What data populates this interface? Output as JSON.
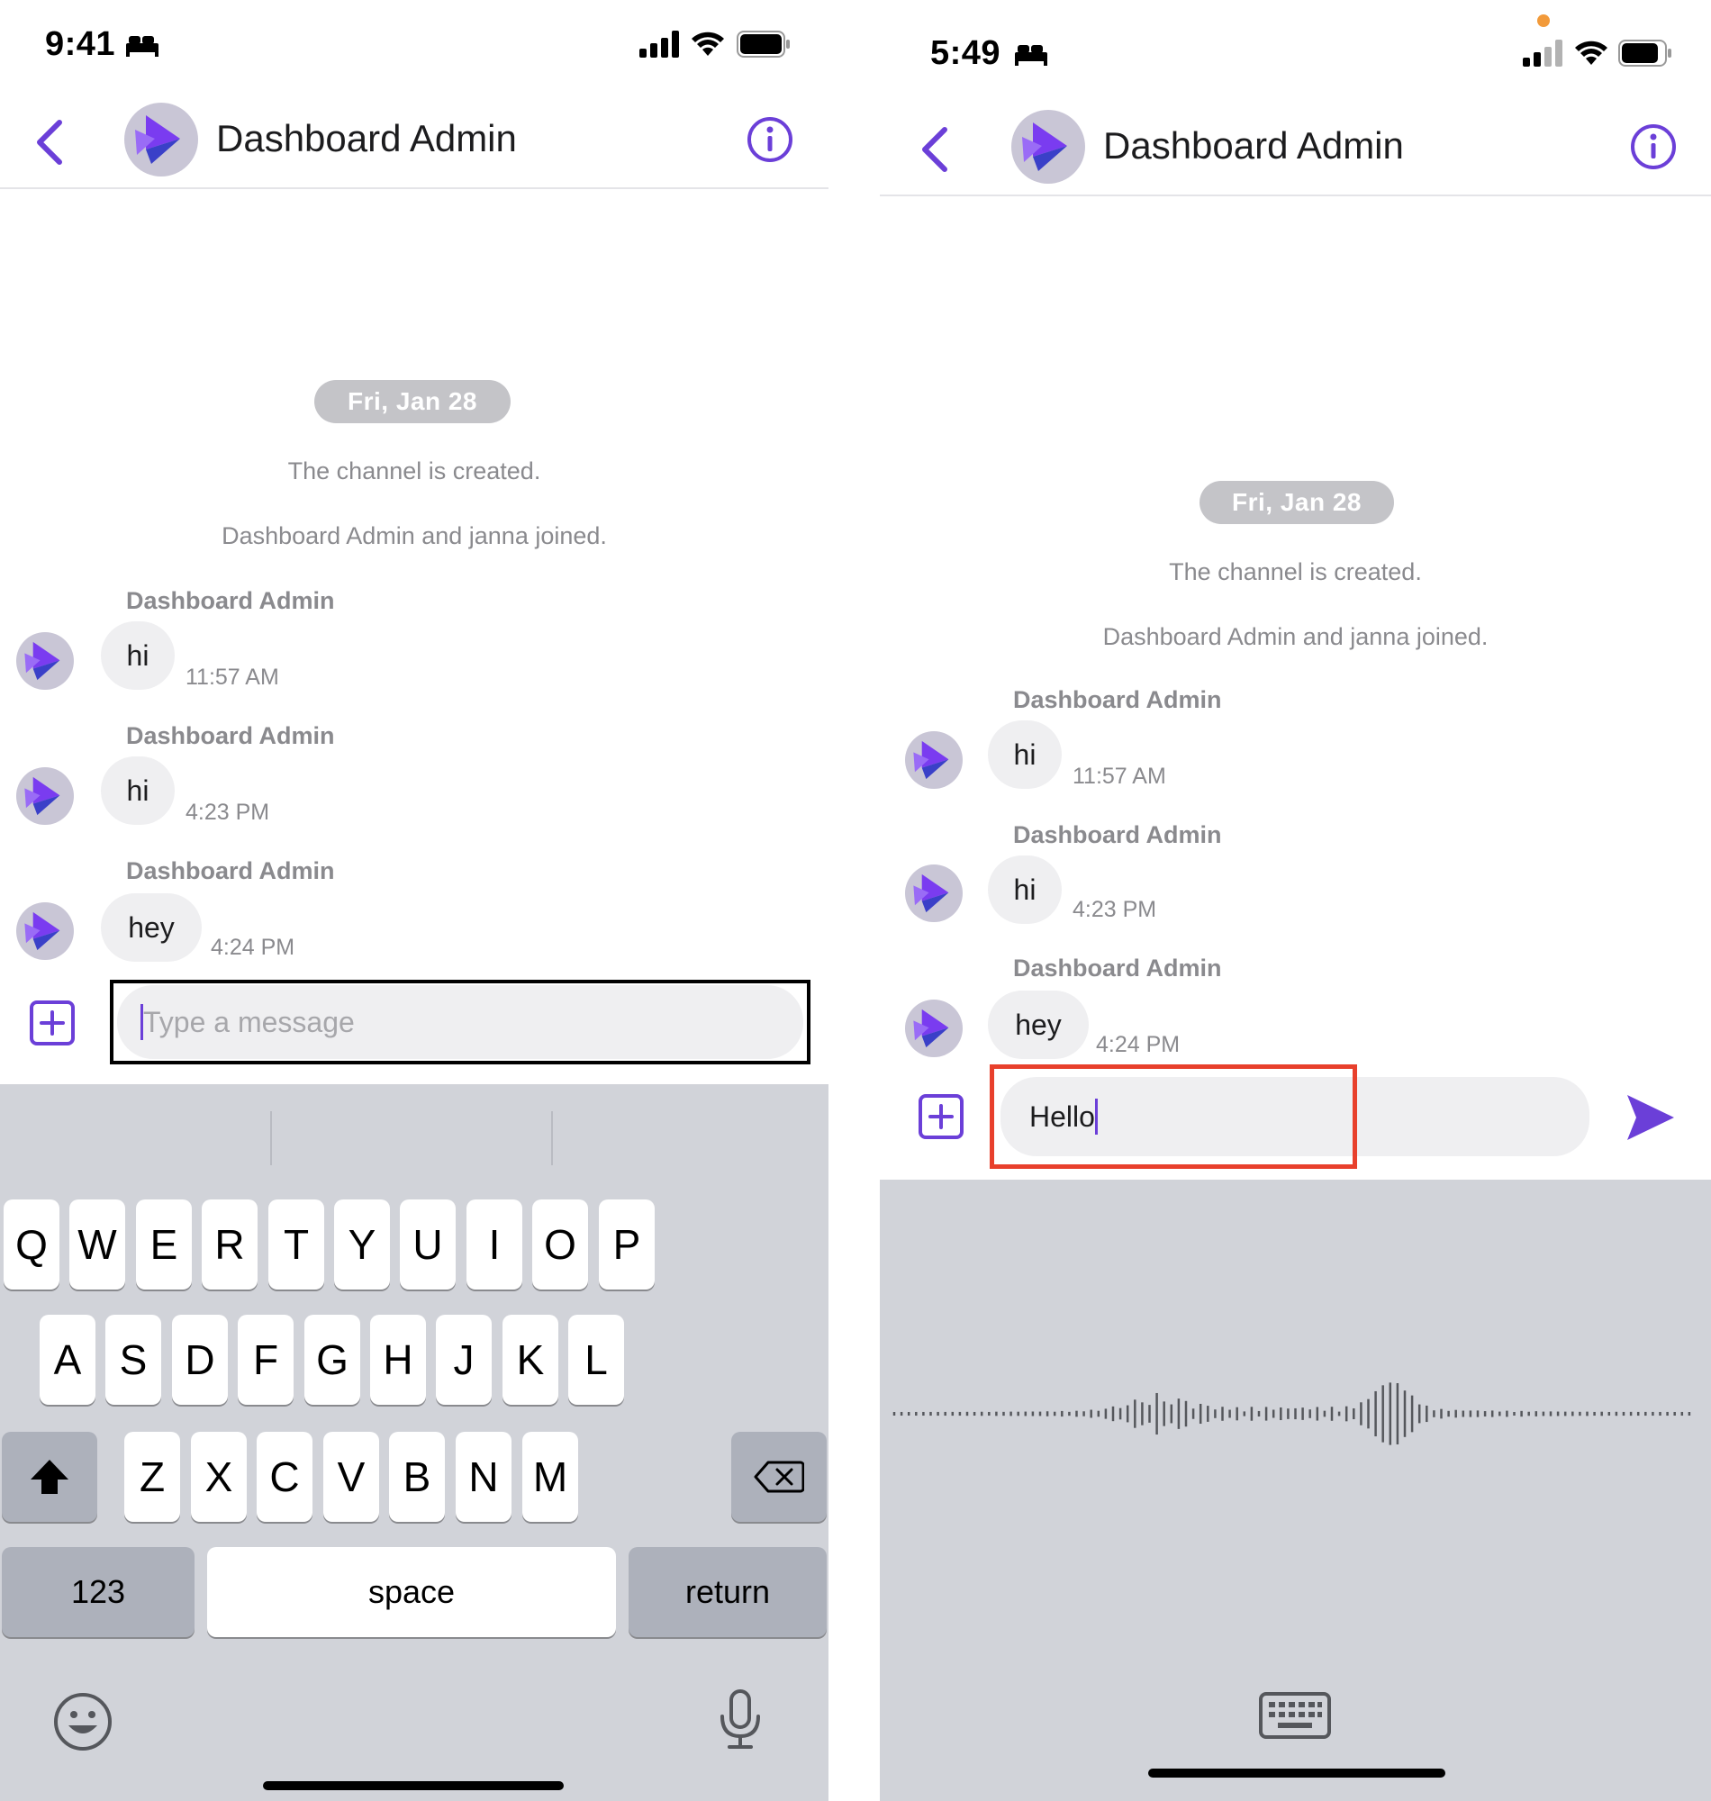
{
  "left_screen": {
    "status_time": "9:41",
    "title": "Dashboard Admin",
    "date_pill": "Fri, Jan 28",
    "system_messages": [
      "The channel is created.",
      "Dashboard Admin and janna joined."
    ],
    "messages": [
      {
        "sender": "Dashboard Admin",
        "text": "hi",
        "time": "11:57 AM"
      },
      {
        "sender": "Dashboard Admin",
        "text": "hi",
        "time": "4:23 PM"
      },
      {
        "sender": "Dashboard Admin",
        "text": "hey",
        "time": "4:24 PM"
      }
    ],
    "input_placeholder": "Type a message",
    "keyboard": {
      "row1": [
        "Q",
        "W",
        "E",
        "R",
        "T",
        "Y",
        "U",
        "I",
        "O",
        "P"
      ],
      "row2": [
        "A",
        "S",
        "D",
        "F",
        "G",
        "H",
        "J",
        "K",
        "L"
      ],
      "row3": [
        "Z",
        "X",
        "C",
        "V",
        "B",
        "N",
        "M"
      ],
      "numbers_key": "123",
      "space_key": "space",
      "return_key": "return"
    }
  },
  "right_screen": {
    "status_time": "5:49",
    "title": "Dashboard Admin",
    "date_pill": "Fri, Jan 28",
    "system_messages": [
      "The channel is created.",
      "Dashboard Admin and janna joined."
    ],
    "messages": [
      {
        "sender": "Dashboard Admin",
        "text": "hi",
        "time": "11:57 AM"
      },
      {
        "sender": "Dashboard Admin",
        "text": "hi",
        "time": "4:23 PM"
      },
      {
        "sender": "Dashboard Admin",
        "text": "hey",
        "time": "4:24 PM"
      }
    ],
    "input_value": "Hello"
  },
  "colors": {
    "accent": "#6b3fd8",
    "highlight_red": "#e8402c",
    "highlight_black": "#000000",
    "keyboard_bg": "#d1d3d9"
  },
  "icons": [
    "bed-icon",
    "signal-icon",
    "wifi-icon",
    "battery-icon",
    "back-icon",
    "info-icon",
    "plus-icon",
    "send-icon",
    "shift-icon",
    "backspace-icon",
    "emoji-icon",
    "mic-icon",
    "keyboard-icon"
  ]
}
